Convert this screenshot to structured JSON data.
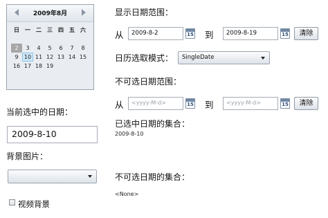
{
  "calendar": {
    "title": "2009年8月",
    "days_of_week": [
      "日",
      "一",
      "二",
      "三",
      "四",
      "五",
      "六"
    ],
    "weeks": [
      [
        "2",
        "3",
        "4",
        "5",
        "6",
        "7",
        "8"
      ],
      [
        "9",
        "10",
        "11",
        "12",
        "13",
        "14",
        "15"
      ],
      [
        "16",
        "17",
        "18",
        "19",
        "",
        "",
        ""
      ]
    ],
    "today_day": "2",
    "selected_day": "10"
  },
  "left": {
    "current_date_label": "当前选中的日期：",
    "current_date_value": "2009-8-10",
    "bg_image_label": "背景图片：",
    "bg_image_value": "",
    "video_bg_label": "视频背景"
  },
  "right": {
    "display_range_label": "显示日期范围：",
    "from_label": "从",
    "to_label": "到",
    "display_from": "2009-8-2",
    "display_to": "2009-8-19",
    "clear_label": "清除",
    "mode_label": "日历选取模式：",
    "mode_value": "SingleDate",
    "blackout_label": "不可选日期范围：",
    "date_placeholder": "<yyyy-M-d>",
    "selected_set_label": "已选中日期的集合：",
    "selected_set_value": "2009-8-10",
    "blackout_set_label": "不可选日期的集合：",
    "blackout_set_value": "<None>",
    "calendar_icon_number": "15"
  }
}
